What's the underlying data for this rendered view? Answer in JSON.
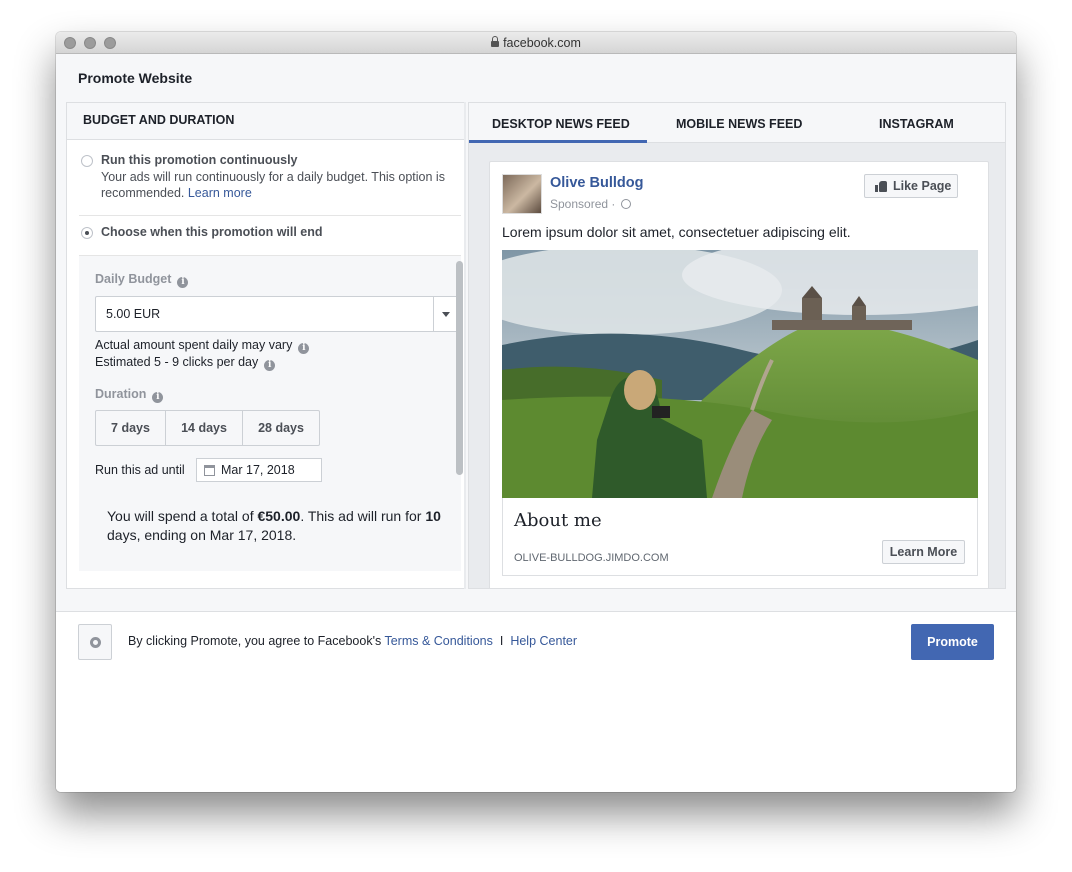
{
  "browser": {
    "url": "facebook.com"
  },
  "dialog": {
    "title": "Promote Website"
  },
  "budget_panel": {
    "header": "BUDGET AND DURATION",
    "option_continuous": {
      "title": "Run this promotion continuously",
      "desc": "Your ads will run continuously for a daily budget. This option is recommended.",
      "learn_more": "Learn more",
      "selected": false
    },
    "option_end": {
      "title": "Choose when this promotion will end",
      "selected": true
    },
    "daily_budget": {
      "label": "Daily Budget",
      "value": "5.00 EUR",
      "note1": "Actual amount spent daily may vary",
      "note2": "Estimated 5 - 9 clicks per day"
    },
    "duration": {
      "label": "Duration",
      "options": [
        "7 days",
        "14 days",
        "28 days"
      ],
      "run_until_label": "Run this ad until",
      "run_until_date": "Mar 17, 2018"
    },
    "summary": {
      "part1": "You will spend a total of ",
      "total": "€50.00",
      "part2": ". This ad will run for ",
      "days": "10",
      "part3": " days, ending on Mar 17, 2018."
    }
  },
  "preview": {
    "tabs": [
      "DESKTOP NEWS FEED",
      "MOBILE NEWS FEED",
      "INSTAGRAM"
    ],
    "active_tab": "DESKTOP NEWS FEED",
    "post": {
      "page_name": "Olive Bulldog",
      "sponsored": "Sponsored ·",
      "like_button": "Like Page",
      "text": "Lorem ipsum dolor sit amet, consectetuer adipiscing elit.",
      "link_title": "About me",
      "link_domain": "OLIVE-BULLDOG.JIMDO.COM",
      "cta": "Learn More"
    }
  },
  "footer": {
    "agree_text": "By clicking Promote, you agree to Facebook's",
    "terms_link": "Terms & Conditions",
    "separator": "I",
    "help_link": "Help Center",
    "promote_button": "Promote"
  },
  "colors": {
    "accent": "#4267b2",
    "link": "#365899",
    "panel_bg": "#f6f7f9"
  }
}
